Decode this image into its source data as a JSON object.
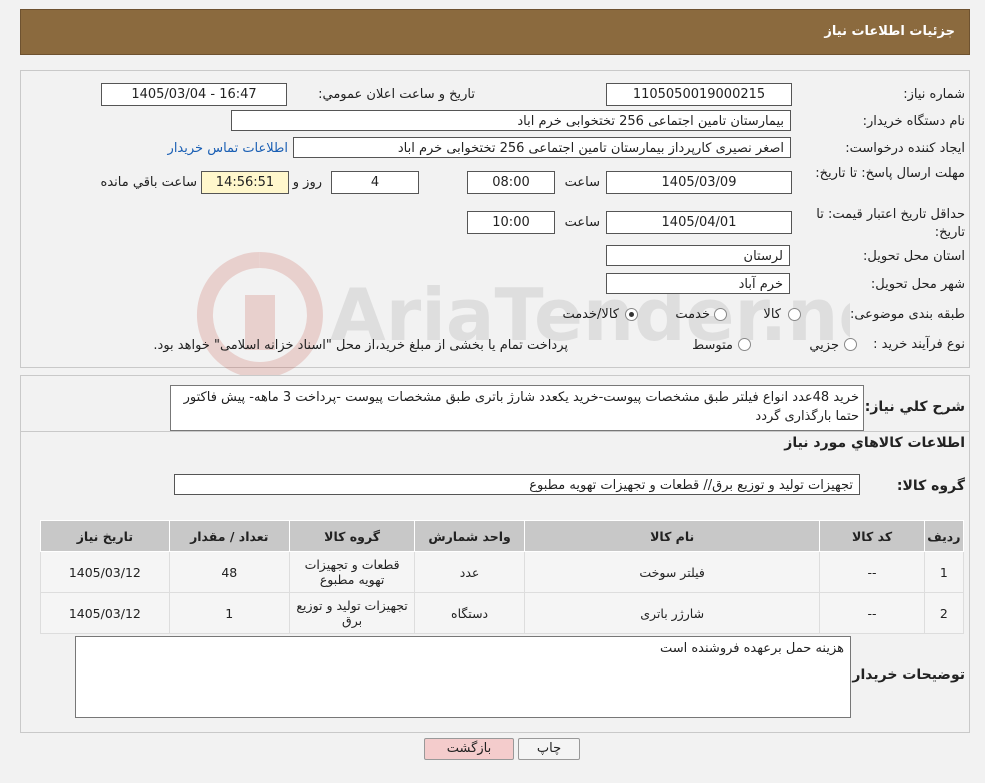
{
  "header": {
    "title": "جزئیات اطلاعات نیاز"
  },
  "form": {
    "need_number_label": "شماره نیاز:",
    "need_number": "1105050019000215",
    "announce_label": "تاریخ و ساعت اعلان عمومي:",
    "announce_value": "1405/03/04 - 16:47",
    "buyer_org_label": "نام دستگاه خریدار:",
    "buyer_org": "بیمارستان تامین اجتماعی  256 تختخوابی خرم اباد",
    "creator_label": "ایجاد کننده درخواست:",
    "creator": "اصغر نصیری کارپرداز بیمارستان تامین اجتماعی  256 تختخوابی خرم اباد",
    "contact_link": "اطلاعات تماس خریدار",
    "deadline_label": "مهلت ارسال پاسخ: تا تاریخ:",
    "deadline_date": "1405/03/09",
    "time_label": "ساعت",
    "deadline_time": "08:00",
    "days_value": "4",
    "days_label": "روز و",
    "remaining_value": "14:56:51",
    "remaining_label": "ساعت باقي مانده",
    "validity_label": "حداقل تاریخ اعتبار قیمت: تا تاریخ:",
    "validity_date": "1405/04/01",
    "validity_time": "10:00",
    "province_label": "استان محل تحویل:",
    "province": "لرستان",
    "city_label": "شهر محل تحویل:",
    "city": "خرم آباد",
    "category_label": "طبقه بندی موضوعی:",
    "category_options": [
      "کالا",
      "خدمت",
      "کالا/خدمت"
    ],
    "process_label": "نوع فرآیند خرید :",
    "process_options": [
      "جزیي",
      "متوسط"
    ],
    "process_note": "پرداخت تمام یا بخشی از مبلغ خرید،از محل \"اسناد خزانه اسلامی\" خواهد بود."
  },
  "description": {
    "label": "شرح کلي نیاز:",
    "text": "خرید 48عدد انواع فیلتر طبق مشخصات پیوست-خرید یکعدد شارژ باتری طبق مشخصات پیوست -پرداخت 3 ماهه- پیش فاکتور حتما بارگذاری گردد"
  },
  "goods": {
    "section_title": "اطلاعات کالاهاي مورد نياز",
    "group_label": "گروه کالا:",
    "group_value": "تجهیزات تولید و توزیع برق//  قطعات و تجهیزات تهویه مطبوع",
    "columns": [
      "رديف",
      "کد کالا",
      "نام کالا",
      "واحد شمارش",
      "گروه کالا",
      "تعداد / مقدار",
      "تاریخ نیاز"
    ],
    "rows": [
      {
        "row": "1",
        "code": "--",
        "name": "فیلتر سوخت",
        "unit": "عدد",
        "group": "قطعات و تجهیزات تهویه مطبوع",
        "qty": "48",
        "date": "1405/03/12"
      },
      {
        "row": "2",
        "code": "--",
        "name": "شارژر باتری",
        "unit": "دستگاه",
        "group": "تجهیزات تولید و توزیع برق",
        "qty": "1",
        "date": "1405/03/12"
      }
    ]
  },
  "buyer_notes": {
    "label": "توضیحات خریدار:",
    "text": "هزینه حمل برعهده فروشنده است"
  },
  "buttons": {
    "print": "چاپ",
    "back": "بازگشت"
  },
  "colors": {
    "header_bg": "#8b6a3e",
    "link": "#1a5fb4",
    "back_btn": "#f4cccc"
  },
  "watermark": {
    "text": "AriaTender.neT"
  }
}
